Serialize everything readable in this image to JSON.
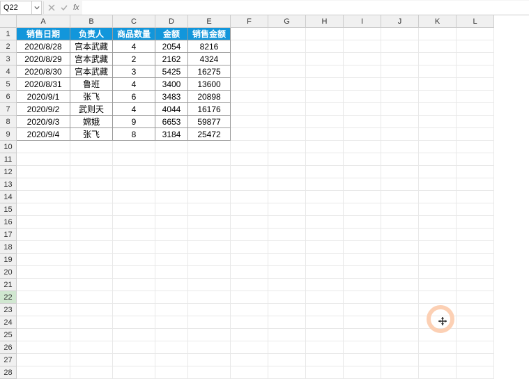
{
  "name_box": "Q22",
  "formula": "",
  "columns": [
    "A",
    "B",
    "C",
    "D",
    "E",
    "F",
    "G",
    "H",
    "I",
    "J",
    "K",
    "L"
  ],
  "col_classes": [
    "cA",
    "cB",
    "cC",
    "cD",
    "cE",
    "cF",
    "cG",
    "cH",
    "cI",
    "cJ",
    "cK",
    "cL"
  ],
  "row_count": 28,
  "selected_row": 22,
  "headers": [
    "销售日期",
    "负责人",
    "商品数量",
    "金额",
    "销售金额"
  ],
  "chart_data": {
    "type": "table",
    "columns": [
      "销售日期",
      "负责人",
      "商品数量",
      "金额",
      "销售金额"
    ],
    "rows": [
      [
        "2020/8/28",
        "宫本武藏",
        4,
        2054,
        8216
      ],
      [
        "2020/8/29",
        "宫本武藏",
        2,
        2162,
        4324
      ],
      [
        "2020/8/30",
        "宫本武藏",
        3,
        5425,
        16275
      ],
      [
        "2020/8/31",
        "鲁班",
        4,
        3400,
        13600
      ],
      [
        "2020/9/1",
        "张飞",
        6,
        3483,
        20898
      ],
      [
        "2020/9/2",
        "武则天",
        4,
        4044,
        16176
      ],
      [
        "2020/9/3",
        "嫦娥",
        9,
        6653,
        59877
      ],
      [
        "2020/9/4",
        "张飞",
        8,
        3184,
        25472
      ]
    ]
  }
}
